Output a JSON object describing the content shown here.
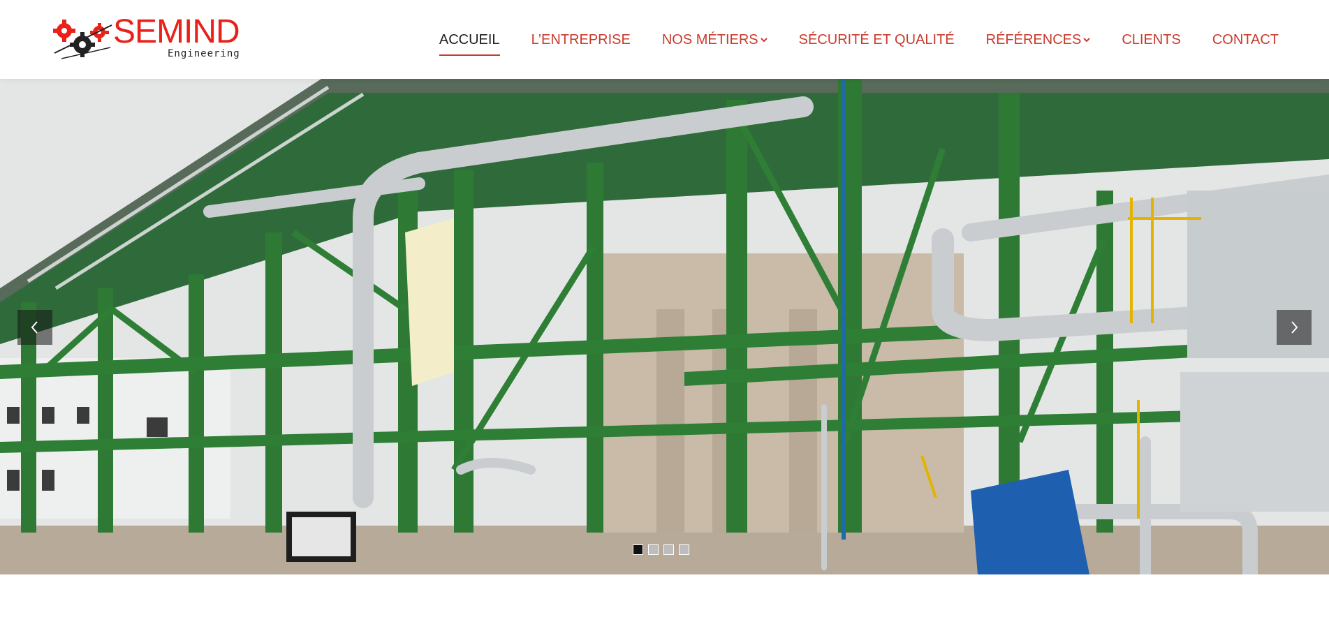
{
  "brand": {
    "name": "SEMIND",
    "tagline": "Engineering",
    "accent_color": "#e8211a",
    "logo_icon": "gears-icon"
  },
  "nav": {
    "items": [
      {
        "label": "ACCUEIL",
        "active": true
      },
      {
        "label": "L’ENTREPRISE"
      },
      {
        "label": "NOS MÉTIERS",
        "dropdown": true
      },
      {
        "label": "SÉCURITÉ ET QUALITÉ"
      },
      {
        "label": "RÉFÉRENCES",
        "dropdown": true
      },
      {
        "label": "CLIENTS"
      },
      {
        "label": "CONTACT"
      }
    ],
    "active_color": "#1f1f1f",
    "link_color": "#c83a2c"
  },
  "slider": {
    "image": "industrial-plant-steel-structure-photo",
    "prev_icon": "chevron-left-icon",
    "next_icon": "chevron-right-icon",
    "slide_count": 4,
    "active_slide": 1
  }
}
